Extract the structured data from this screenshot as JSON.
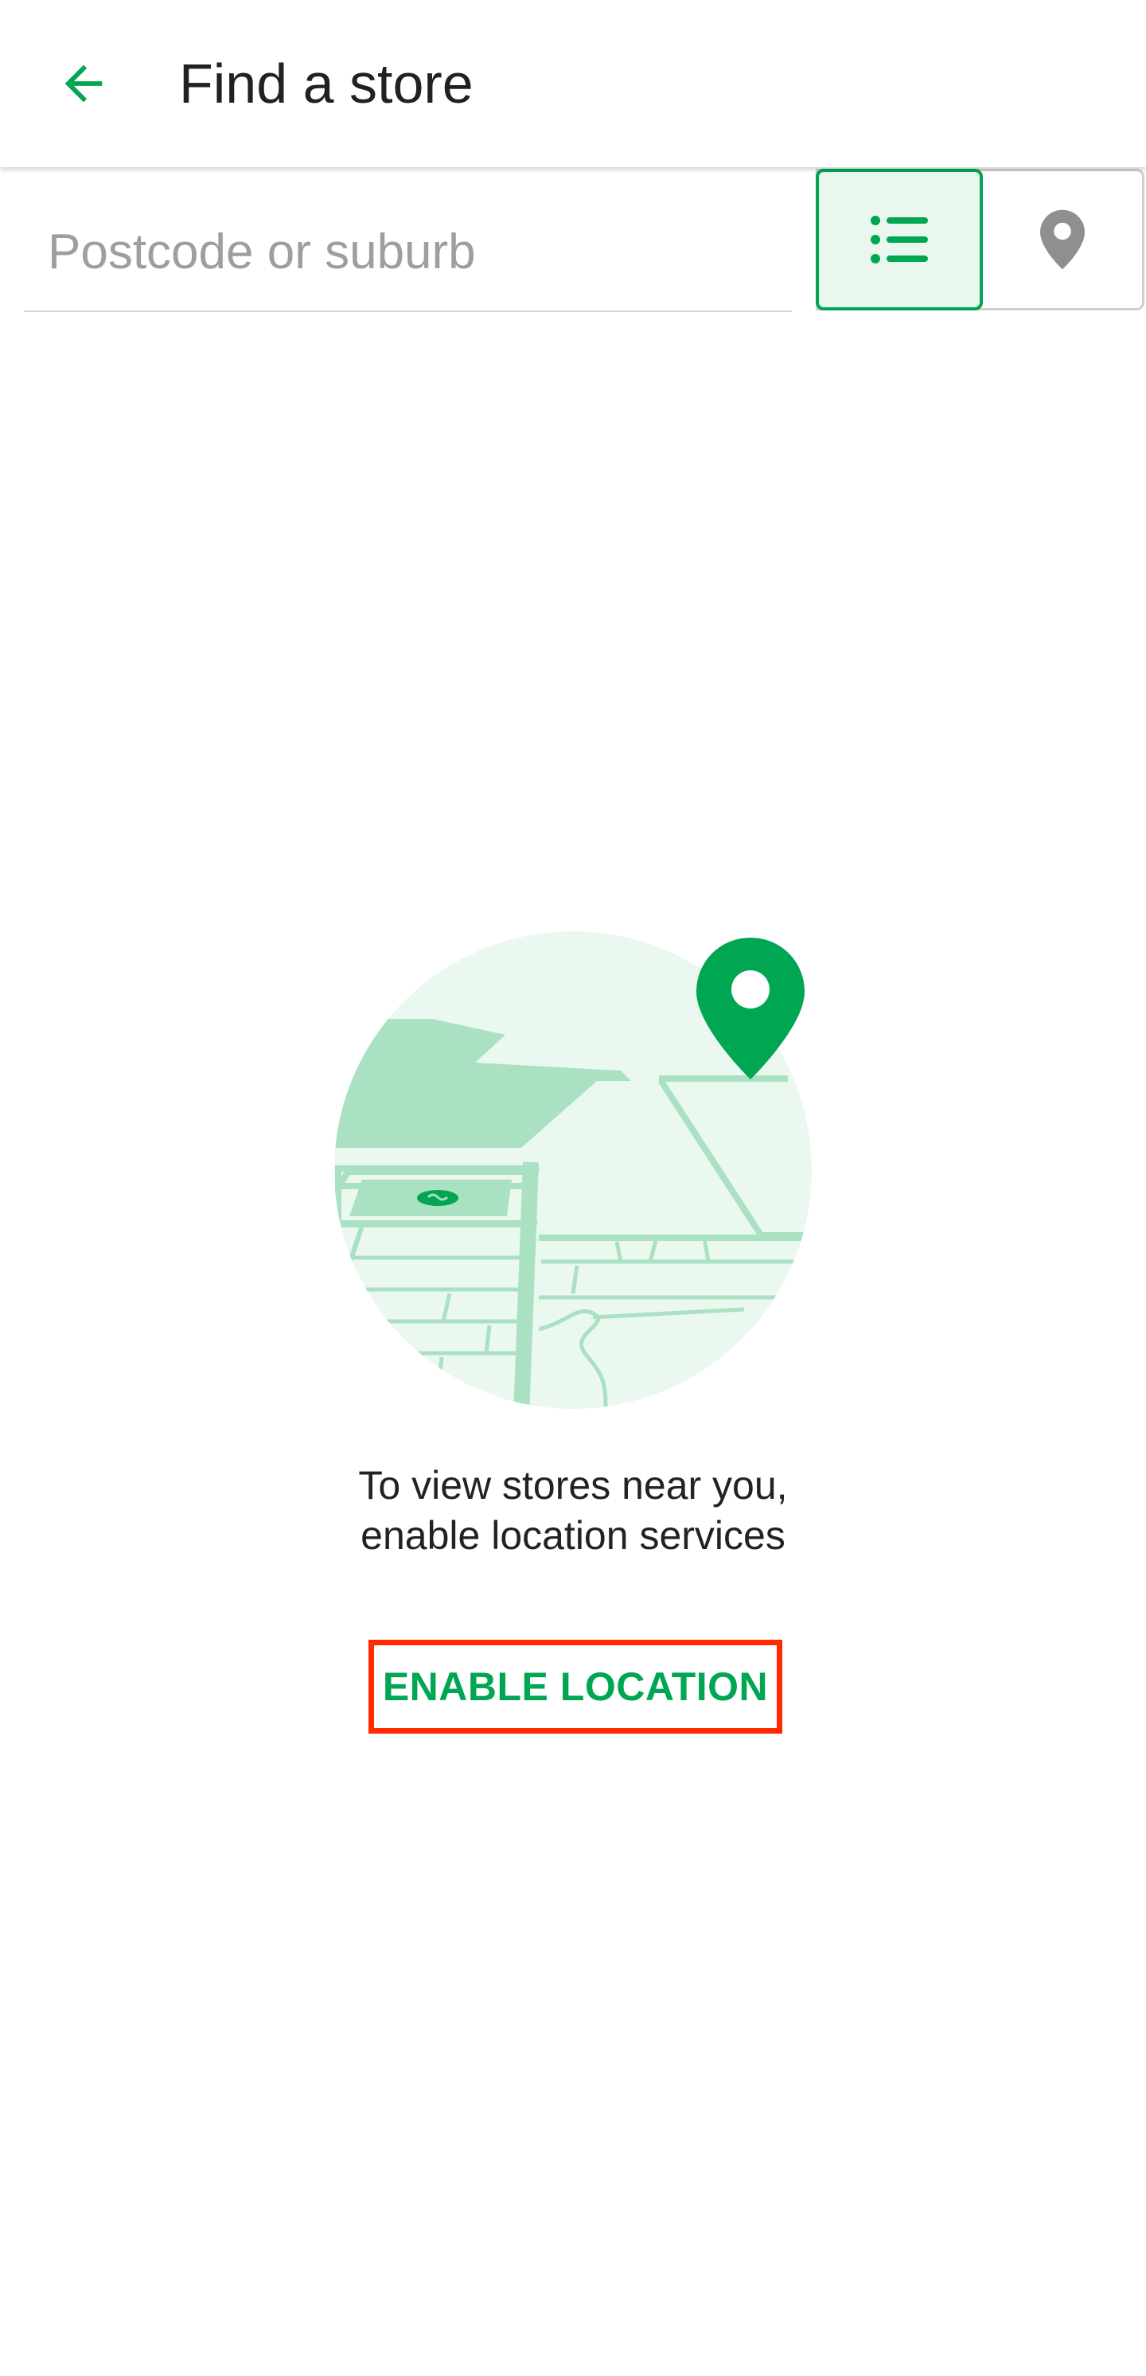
{
  "app_bar": {
    "title": "Find a store",
    "back_icon": "arrow-left-icon"
  },
  "search": {
    "placeholder": "Postcode or suburb",
    "value": ""
  },
  "view_toggle": {
    "list_icon": "list-icon",
    "map_icon": "map-pin-icon",
    "selected": "list"
  },
  "empty_state": {
    "illustration_icon": "store-map-illustration",
    "message_line1": "To view stores near you,",
    "message_line2": "enable location services",
    "button_label": "ENABLE LOCATION"
  },
  "colors": {
    "brand_green": "#00a651",
    "light_green": "#eaf7ef",
    "map_green": "#a9e1c2",
    "highlight_red": "#ff2a00"
  }
}
